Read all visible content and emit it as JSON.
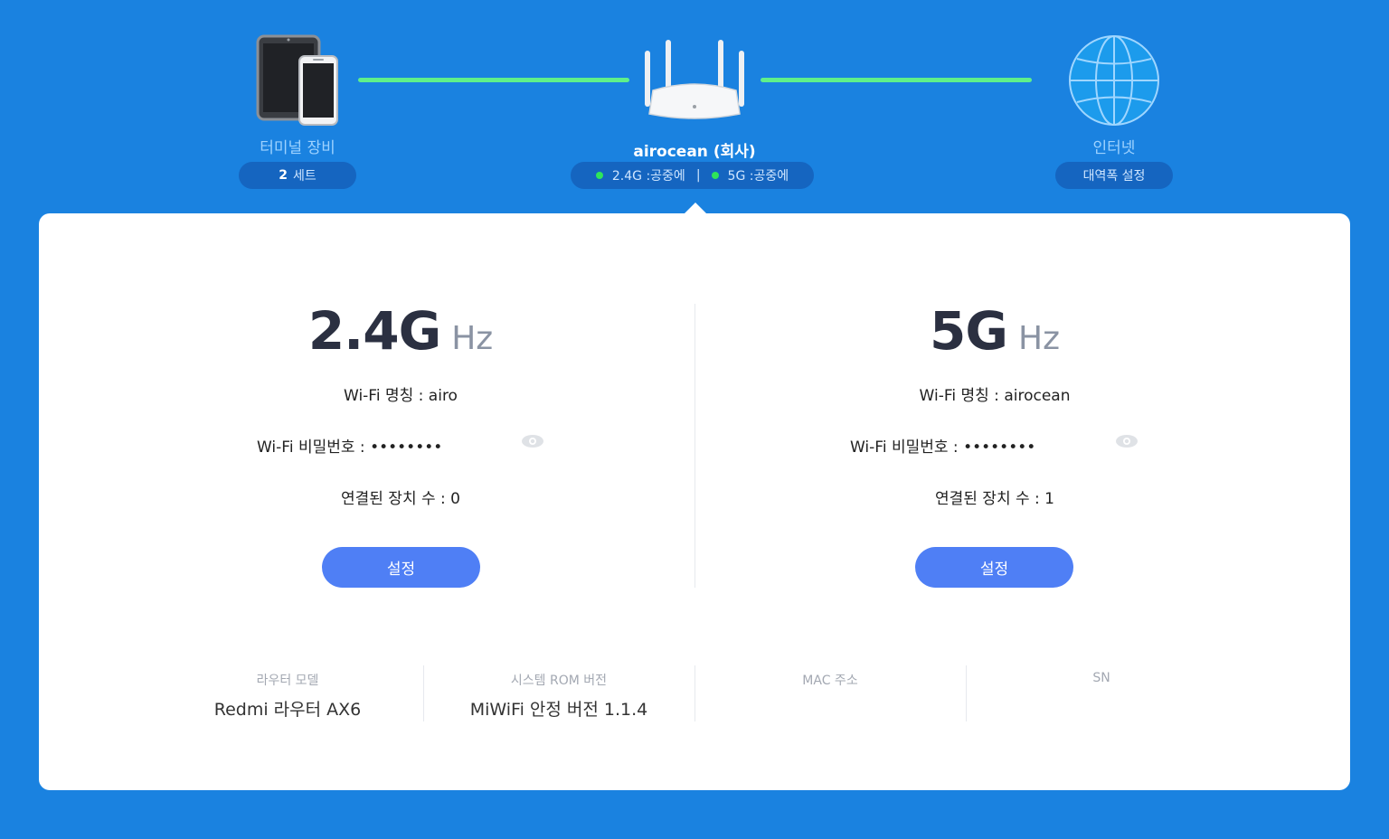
{
  "topology": {
    "terminal": {
      "label": "터미널 장비",
      "count": "2",
      "count_unit": "세트"
    },
    "router": {
      "name": "airocean (회사)",
      "band24_status": "2.4G :공중에",
      "band5_status": "5G :공중에"
    },
    "internet": {
      "label": "인터넷",
      "bandwidth_button": "대역폭 설정"
    }
  },
  "bands": [
    {
      "freq": "2.4G",
      "unit": "Hz",
      "ssid_label": "Wi-Fi 명칭 : ",
      "ssid_value": "airo",
      "password_label": "Wi-Fi 비밀번호 : ",
      "password_value": "••••••••",
      "devices_label": "연결된 장치 수 : ",
      "devices_value": "0",
      "settings_button": "설정"
    },
    {
      "freq": "5G",
      "unit": "Hz",
      "ssid_label": "Wi-Fi 명칭 : ",
      "ssid_value": "airocean",
      "password_label": "Wi-Fi 비밀번호 : ",
      "password_value": "••••••••",
      "devices_label": "연결된 장치 수 : ",
      "devices_value": "1",
      "settings_button": "설정"
    }
  ],
  "info": [
    {
      "label": "라우터 모델",
      "value": "Redmi 라우터 AX6"
    },
    {
      "label": "시스템 ROM 버전",
      "value": "MiWiFi 안정 버전 1.1.4"
    },
    {
      "label": "MAC 주소",
      "value": ""
    },
    {
      "label": "SN",
      "value": ""
    }
  ],
  "colors": {
    "background": "#1a82e0",
    "accent": "#4f7ff5",
    "link": "#5ff08a",
    "status_dot": "#2ee55a"
  }
}
